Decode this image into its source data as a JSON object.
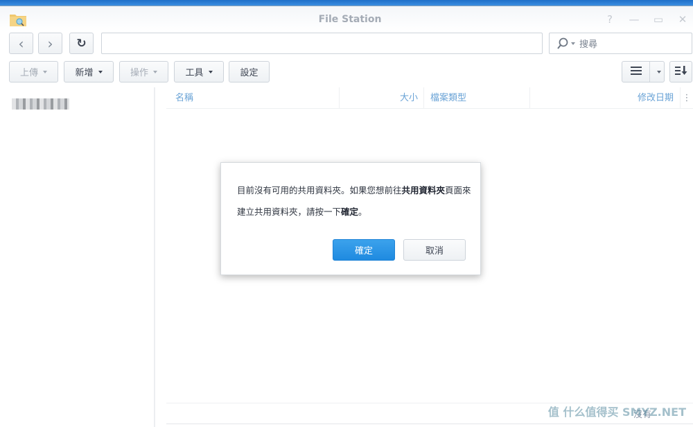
{
  "window": {
    "title": "File Station",
    "controls": {
      "help": "?",
      "minimize": "—",
      "maximize": "▭",
      "close": "✕"
    }
  },
  "toolbar": {
    "back_icon": "‹",
    "forward_icon": "›",
    "refresh_icon": "↻",
    "path_value": "",
    "search_placeholder": "搜尋",
    "buttons": [
      {
        "label": "上傳",
        "disabled": true,
        "dropdown": true
      },
      {
        "label": "新增",
        "disabled": false,
        "dropdown": true
      },
      {
        "label": "操作",
        "disabled": true,
        "dropdown": true
      },
      {
        "label": "工具",
        "disabled": false,
        "dropdown": true
      },
      {
        "label": "設定",
        "disabled": false,
        "dropdown": false
      }
    ]
  },
  "grid": {
    "columns": [
      {
        "label": "名稱"
      },
      {
        "label": "大小"
      },
      {
        "label": "檔案類型"
      },
      {
        "label": "修改日期"
      }
    ],
    "column_menu_icon": "⋮"
  },
  "status": {
    "text": "沒有"
  },
  "watermark": "值 什么值得买 SMYZ.NET",
  "dialog": {
    "message_parts": [
      {
        "text": "目前沒有可用的共用資料夾。如果您想前往",
        "bold": false
      },
      {
        "text": "共用資料夾",
        "bold": true
      },
      {
        "text": "頁面來建立共用資料夾，請按一下",
        "bold": false
      },
      {
        "text": "確定",
        "bold": true
      },
      {
        "text": "。",
        "bold": false
      }
    ],
    "ok_label": "確定",
    "cancel_label": "取消"
  },
  "colors": {
    "accent": "#2490e4",
    "header_text": "#6aa3d6",
    "title_text": "#a4abb5"
  }
}
